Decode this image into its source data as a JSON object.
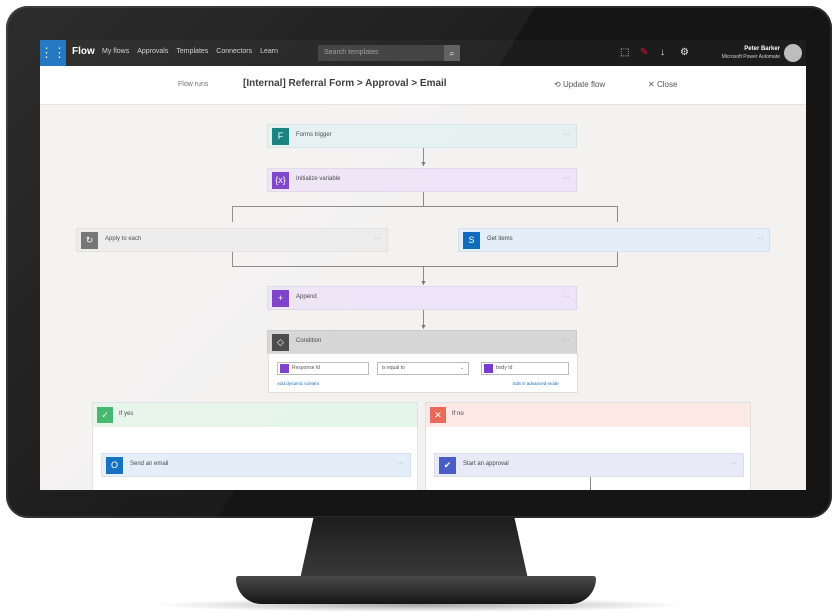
{
  "app": {
    "brand": "Flow",
    "waffle_icon": "waffle-icon",
    "nav": [
      "My flows",
      "Approvals",
      "Templates",
      "Connectors",
      "Learn"
    ],
    "search_placeholder": "Search templates",
    "user_name": "Peter Barker",
    "user_org": "Microsoft Power Automate"
  },
  "command_bar": {
    "back": "Flow runs",
    "title": "[Internal] Referral Form > Approval > Email",
    "update": "Update flow",
    "close": "Close"
  },
  "flow": {
    "steps": [
      {
        "label": "Forms trigger",
        "color": "#0e7c7b",
        "icon": "forms-icon"
      },
      {
        "label": "Initialize variable",
        "color": "#7a3dc8",
        "icon": "variable-icon"
      },
      {
        "label": "Apply to each",
        "color": "#6d6d6d",
        "icon": "loop-icon"
      },
      {
        "label": "Get items",
        "color": "#0f6cbd",
        "icon": "sharepoint-icon"
      },
      {
        "label": "Append",
        "color": "#7a3dc8",
        "icon": "append-icon"
      },
      {
        "label": "Condition",
        "color": "#464646",
        "icon": "condition-icon"
      }
    ],
    "condition": {
      "left_value": "Response Id",
      "operator": "is equal to",
      "right_value": "body Id",
      "add_dynamic": "Add dynamic content",
      "edit_advanced": "Edit in advanced mode"
    },
    "branches": {
      "yes": {
        "label": "If yes",
        "color": "#3fb56a",
        "action": "Send an email"
      },
      "no": {
        "label": "If no",
        "color": "#ea6a5a",
        "action": "Start an approval"
      }
    }
  },
  "colors": {
    "accent": "#0f6cbd",
    "topbar": "#1c1c1c"
  }
}
